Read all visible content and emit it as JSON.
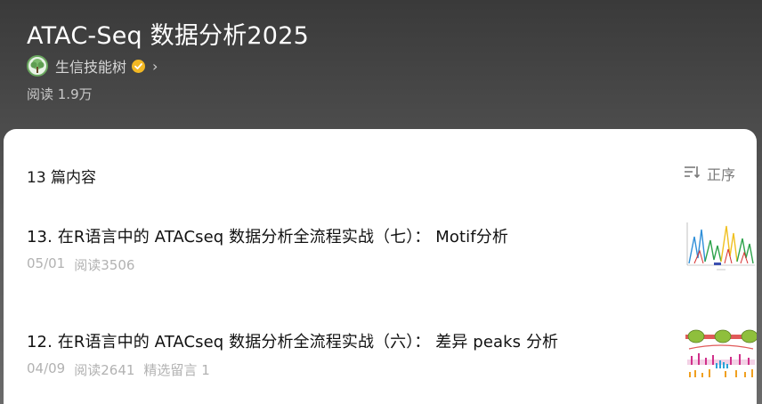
{
  "header": {
    "title": "ATAC-Seq 数据分析2025",
    "author": {
      "name": "生信技能树",
      "avatar_icon": "tree-avatar-icon",
      "verified_icon": "verified-badge-icon"
    },
    "reads": "阅读 1.9万"
  },
  "list": {
    "count_label": "13 篇内容",
    "sort_label": "正序",
    "sort_icon": "sort-icon",
    "articles": [
      {
        "title": "13. 在R语言中的 ATACseq 数据分析全流程实战（七）： Motif分析",
        "date": "05/01",
        "reads": "阅读3506",
        "thumbnail_icon": "motif-logo-thumbnail"
      },
      {
        "title": "12. 在R语言中的 ATACseq 数据分析全流程实战（六）： 差异 peaks 分析",
        "date": "04/09",
        "reads": "阅读2641",
        "comments": "精选留言 1",
        "thumbnail_icon": "peaks-diagram-thumbnail"
      }
    ]
  },
  "colors": {
    "header_bg_top": "#3a3a3a",
    "header_bg_bottom": "#6a6a6a",
    "verified": "#f2b824",
    "avatar_green": "#6aa85f"
  }
}
